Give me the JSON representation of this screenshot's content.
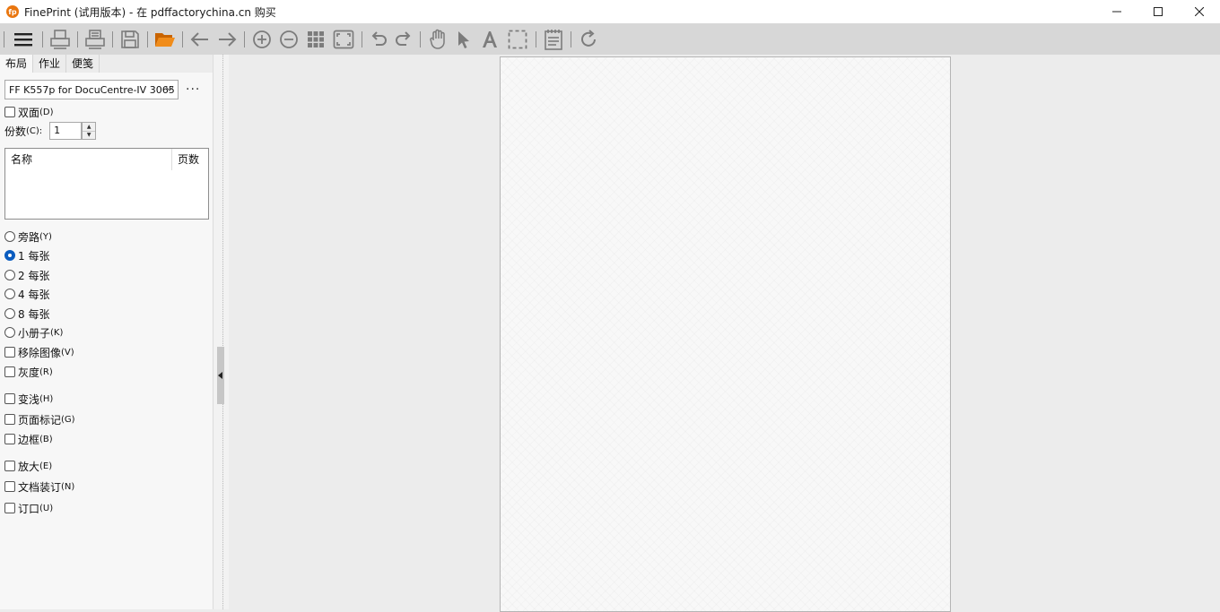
{
  "window": {
    "title": "FinePrint (试用版本) - 在 pdffactorychina.cn 购买",
    "logo_text": "fp"
  },
  "toolbar": {
    "icons": [
      "menu-icon",
      "print-icon",
      "print-properties-icon",
      "save-icon",
      "open-folder-icon",
      "arrow-left-icon",
      "arrow-right-icon",
      "zoom-in-icon",
      "zoom-out-icon",
      "grid-icon",
      "fit-page-icon",
      "undo-icon",
      "redo-icon",
      "hand-icon",
      "pointer-icon",
      "text-icon",
      "select-rect-icon",
      "notepad-icon",
      "refresh-icon"
    ]
  },
  "tabs": [
    {
      "label": "布局",
      "active": true
    },
    {
      "label": "作业",
      "active": false
    },
    {
      "label": "便笺",
      "active": false
    }
  ],
  "printer": {
    "selected": "FF K557p for DocuCentre-IV 3065",
    "more": "···"
  },
  "duplex": {
    "label": "双面",
    "suffix": "(D)",
    "checked": false
  },
  "copies": {
    "label": "份数",
    "suffix": "(C):",
    "value": "1"
  },
  "jobs_list": {
    "columns": [
      "名称",
      "页数"
    ],
    "rows": []
  },
  "layout_options": [
    {
      "type": "radio",
      "label": "旁路",
      "suffix": "(Y)",
      "checked": false
    },
    {
      "type": "radio",
      "label": "1 每张",
      "suffix": "",
      "checked": true
    },
    {
      "type": "radio",
      "label": "2 每张",
      "suffix": "",
      "checked": false
    },
    {
      "type": "radio",
      "label": "4 每张",
      "suffix": "",
      "checked": false
    },
    {
      "type": "radio",
      "label": "8 每张",
      "suffix": "",
      "checked": false
    },
    {
      "type": "radio",
      "label": "小册子",
      "suffix": "(K)",
      "checked": false
    },
    {
      "type": "check",
      "label": "移除图像",
      "suffix": "(V)",
      "checked": false
    },
    {
      "type": "check",
      "label": "灰度",
      "suffix": "(R)",
      "checked": false
    },
    {
      "type": "check",
      "label": "变浅",
      "suffix": "(H)",
      "checked": false
    },
    {
      "type": "check",
      "label": "页面标记",
      "suffix": "(G)",
      "checked": false
    },
    {
      "type": "check",
      "label": "边框",
      "suffix": "(B)",
      "checked": false
    },
    {
      "type": "check",
      "label": "放大",
      "suffix": "(E)",
      "checked": false
    },
    {
      "type": "check",
      "label": "文档装订",
      "suffix": "(N)",
      "checked": false
    },
    {
      "type": "check",
      "label": "订口",
      "suffix": "(U)",
      "checked": false
    }
  ],
  "colors": {
    "accent": "#0a5cbf",
    "folder": "#e9760f",
    "toolbar_bg": "#d7d7d7"
  }
}
